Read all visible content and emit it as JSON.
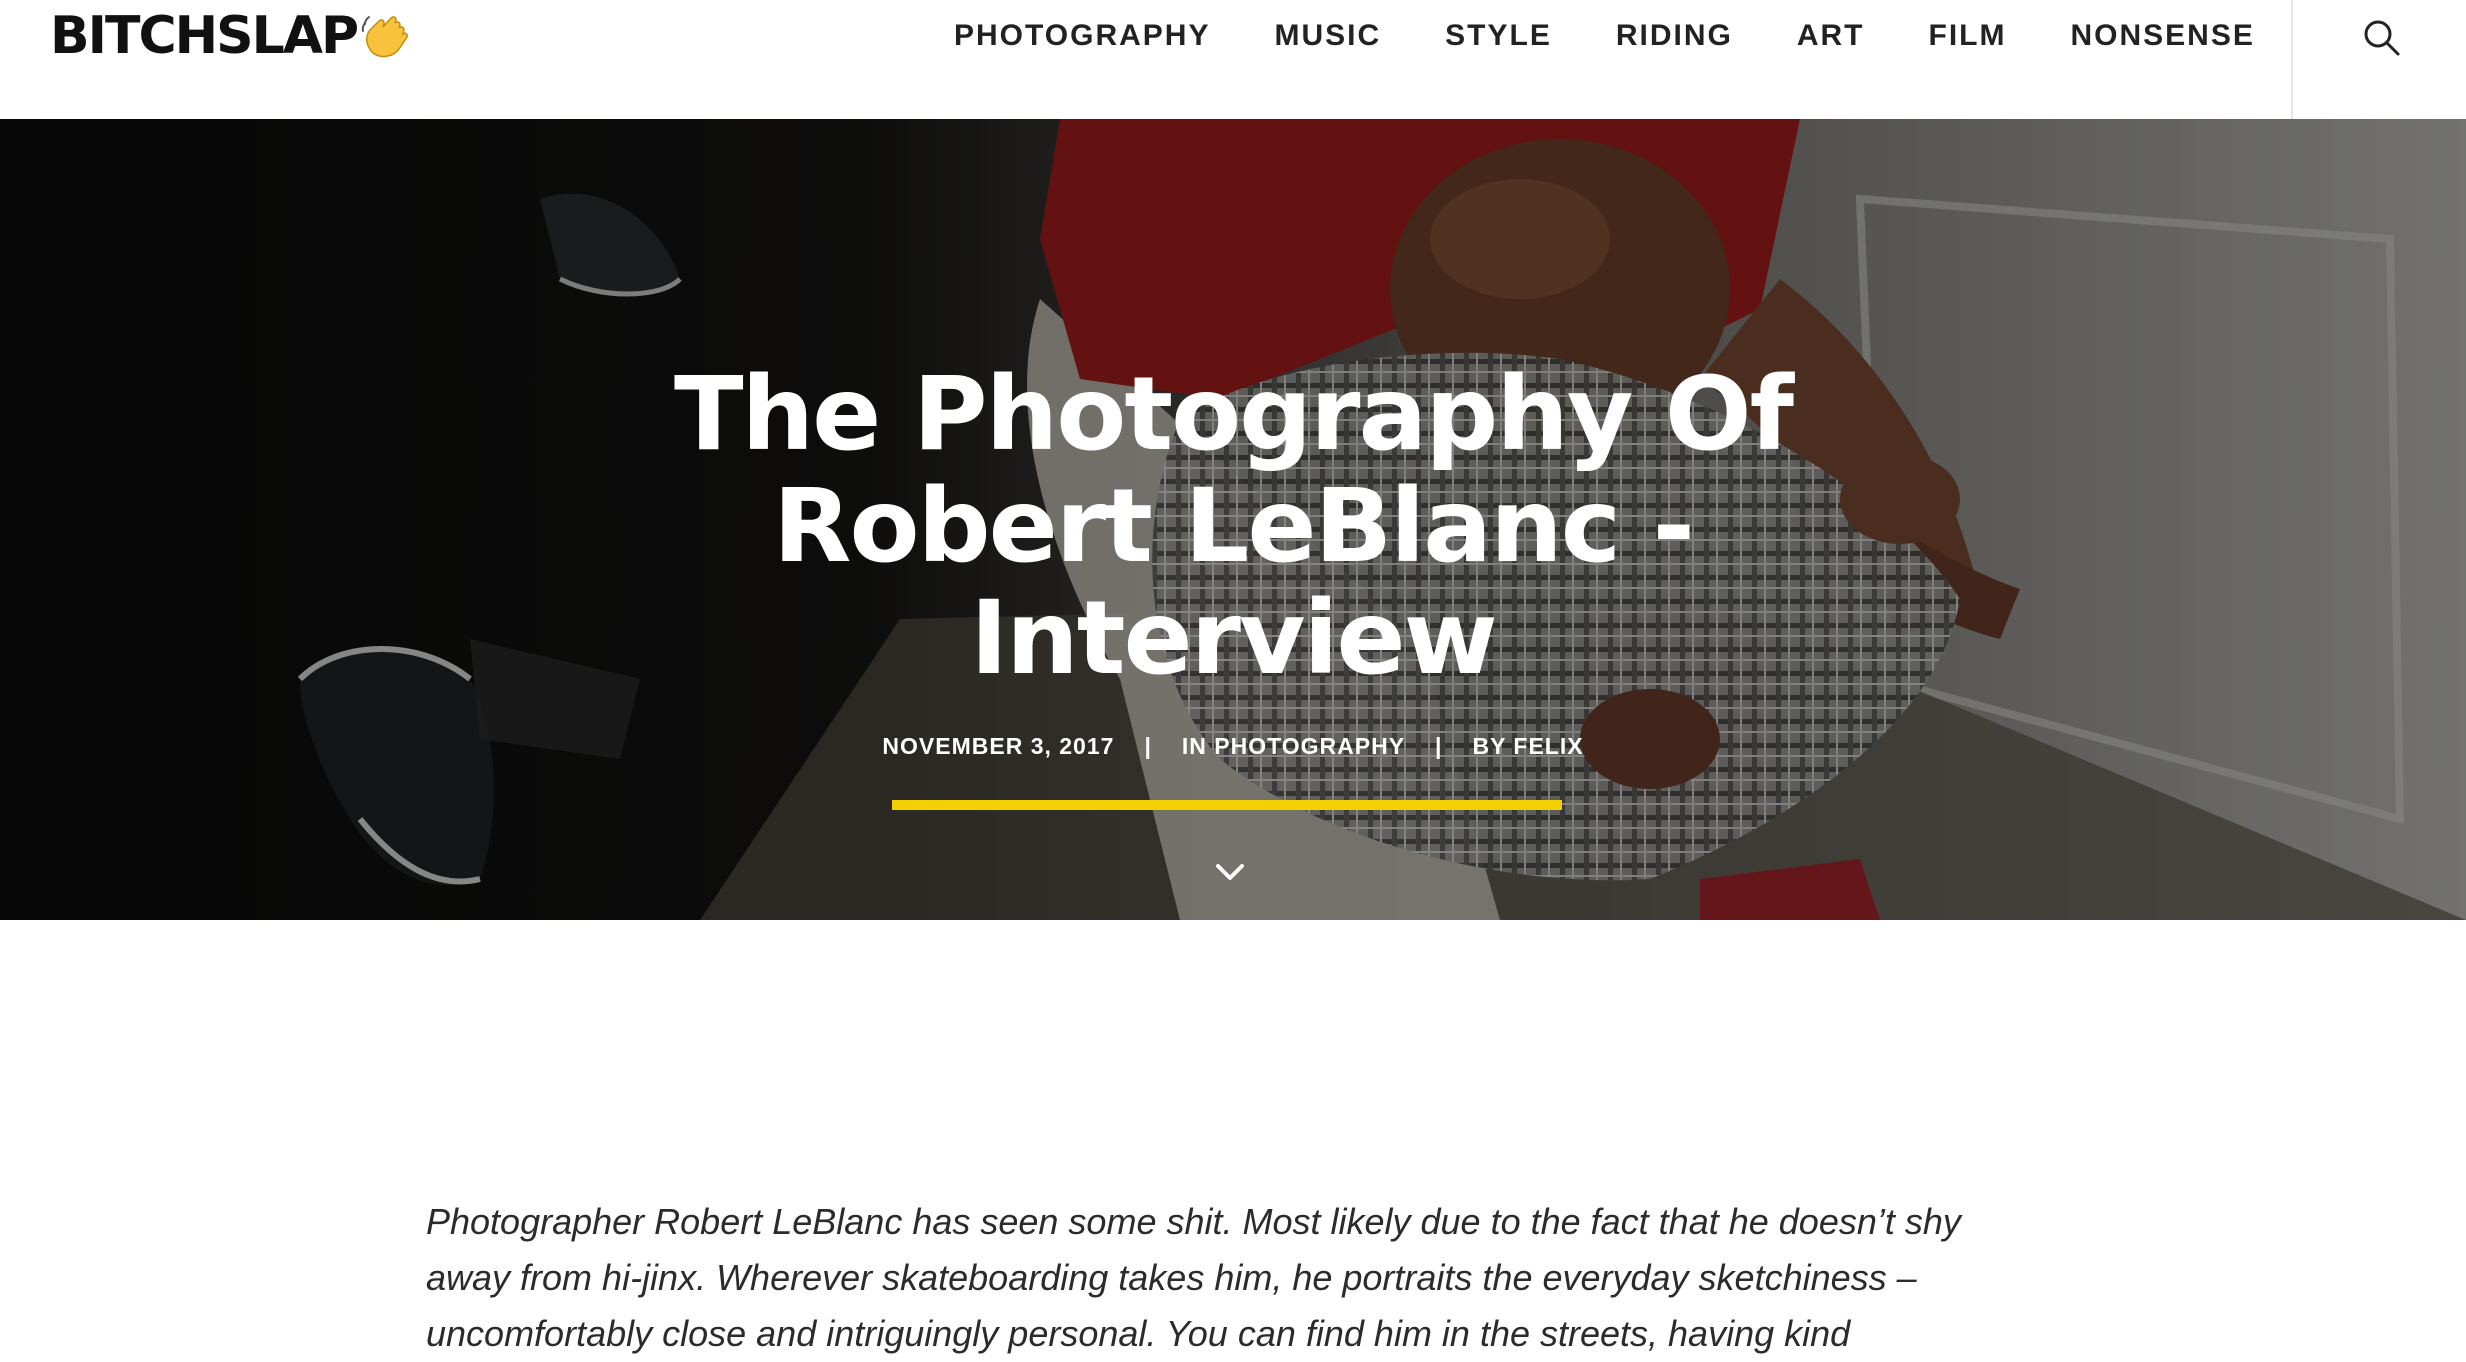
{
  "header": {
    "logo_text": "BITCHSLAP",
    "logo_icon": "waving-hand-icon",
    "nav": [
      {
        "label": "PHOTOGRAPHY"
      },
      {
        "label": "MUSIC"
      },
      {
        "label": "STYLE"
      },
      {
        "label": "RIDING"
      },
      {
        "label": "ART"
      },
      {
        "label": "FILM"
      },
      {
        "label": "NONSENSE"
      }
    ],
    "search_icon": "search-icon"
  },
  "hero": {
    "title": "The Photography Of Robert LeBlanc - Interview",
    "date": "NOVEMBER 3, 2017",
    "category": "IN PHOTOGRAPHY",
    "author": "BY FELIX",
    "separator": "|",
    "accent_color": "#f5d000",
    "scroll_icon": "chevron-down-icon"
  },
  "article": {
    "intro": "Photographer Robert LeBlanc has seen some shit. Most likely due to the fact that he doesn’t shy away from hi-jinx. Wherever skateboarding takes him, he portraits the everyday sketchiness – uncomfortably close and intriguingly personal. You can find him in the streets, having kind"
  }
}
